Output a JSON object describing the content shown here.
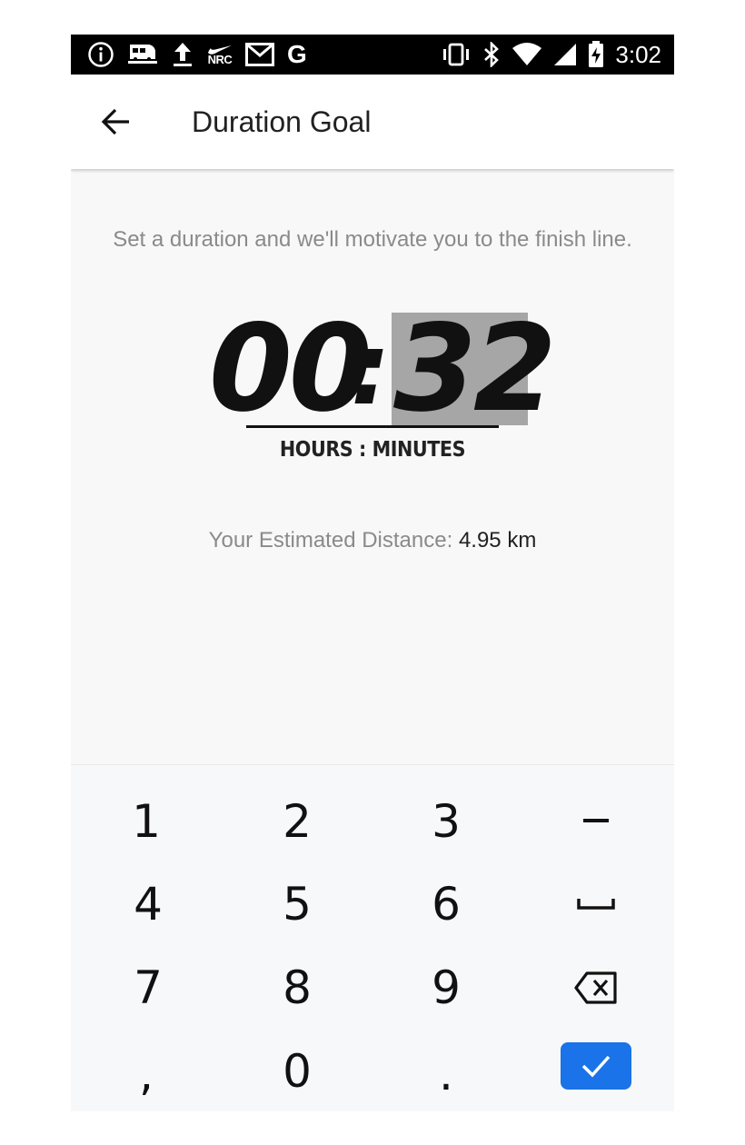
{
  "status_bar": {
    "left_icons": [
      "info-icon",
      "train-icon",
      "upload-icon",
      "nike-nrc-icon",
      "gmail-icon",
      "google-icon"
    ],
    "nrc_label": "NRC",
    "google_label": "G",
    "right_icons": [
      "vibrate-icon",
      "bluetooth-icon",
      "wifi-icon",
      "signal-icon",
      "battery-charging-icon"
    ],
    "time": "3:02"
  },
  "app_bar": {
    "back_icon": "arrow-left-icon",
    "title": "Duration Goal"
  },
  "content": {
    "subtitle": "Set a duration and we'll motivate you to the finish line.",
    "timer": {
      "hours": "00",
      "separator": ":",
      "minutes": "32"
    },
    "units_label": "HOURS : MINUTES",
    "estimate_label": "Your Estimated Distance:",
    "estimate_value": "4.95 km"
  },
  "keypad": {
    "keys": [
      "1",
      "2",
      "3",
      "−",
      "4",
      "5",
      "6",
      "␣",
      "7",
      "8",
      "9",
      "⌫",
      ",",
      "0",
      ".",
      "✓"
    ],
    "accent": "#1a73e8"
  }
}
